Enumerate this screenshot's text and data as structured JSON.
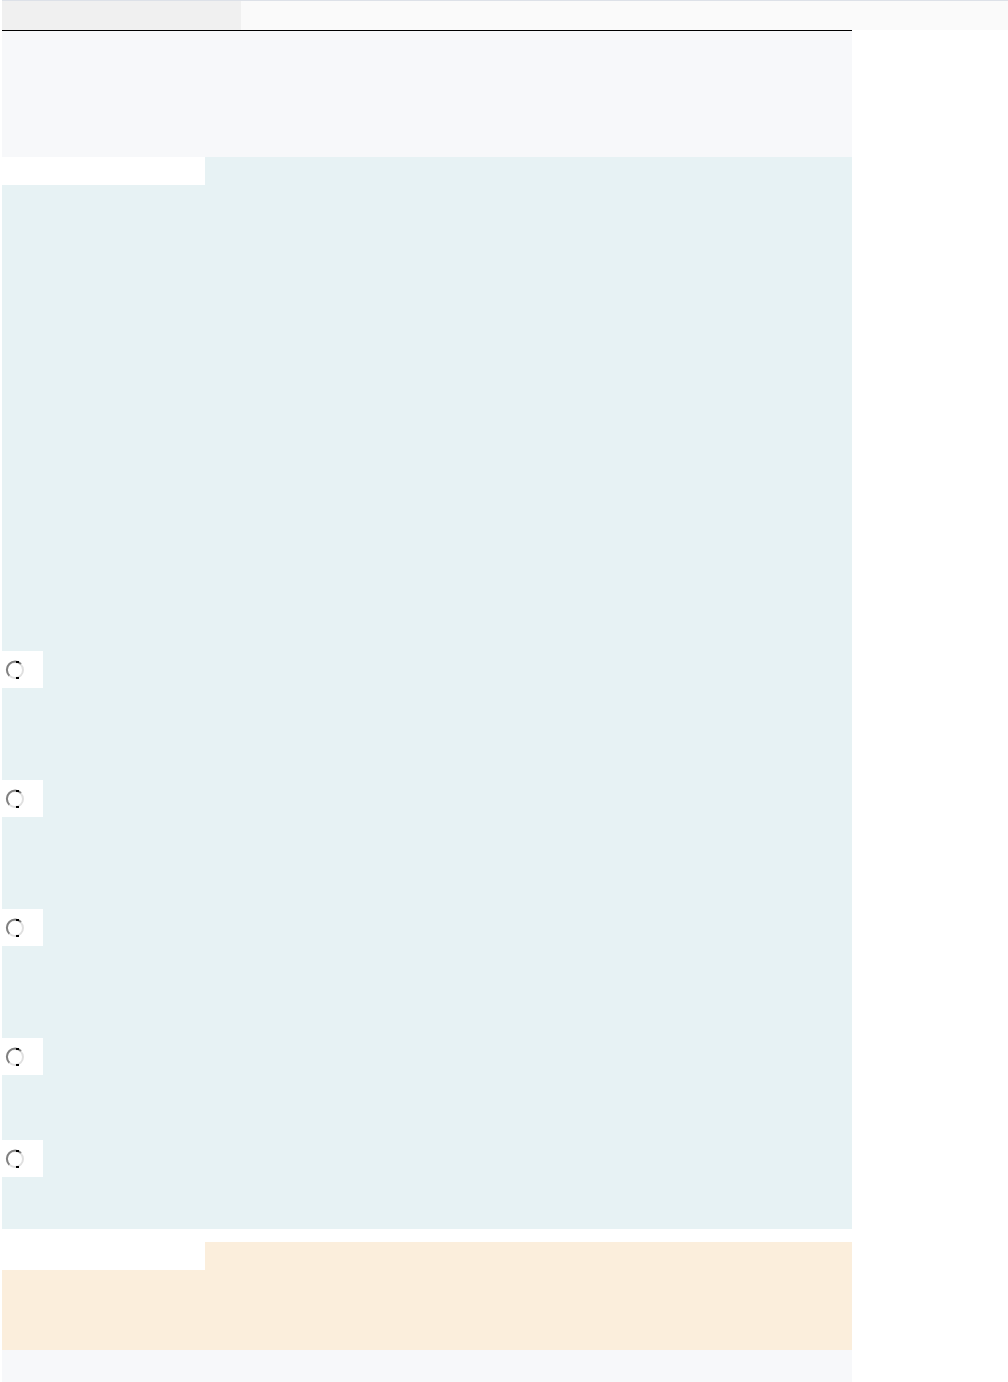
{
  "tab_bar": {
    "tabs": [
      {
        "selected": true
      }
    ]
  },
  "sections": [
    {
      "kind": "question",
      "color": "#e7f2f4",
      "options": [
        {
          "selected": false
        },
        {
          "selected": false
        },
        {
          "selected": false
        },
        {
          "selected": false
        },
        {
          "selected": false
        }
      ]
    },
    {
      "kind": "note",
      "color": "#fbeedc"
    }
  ]
}
